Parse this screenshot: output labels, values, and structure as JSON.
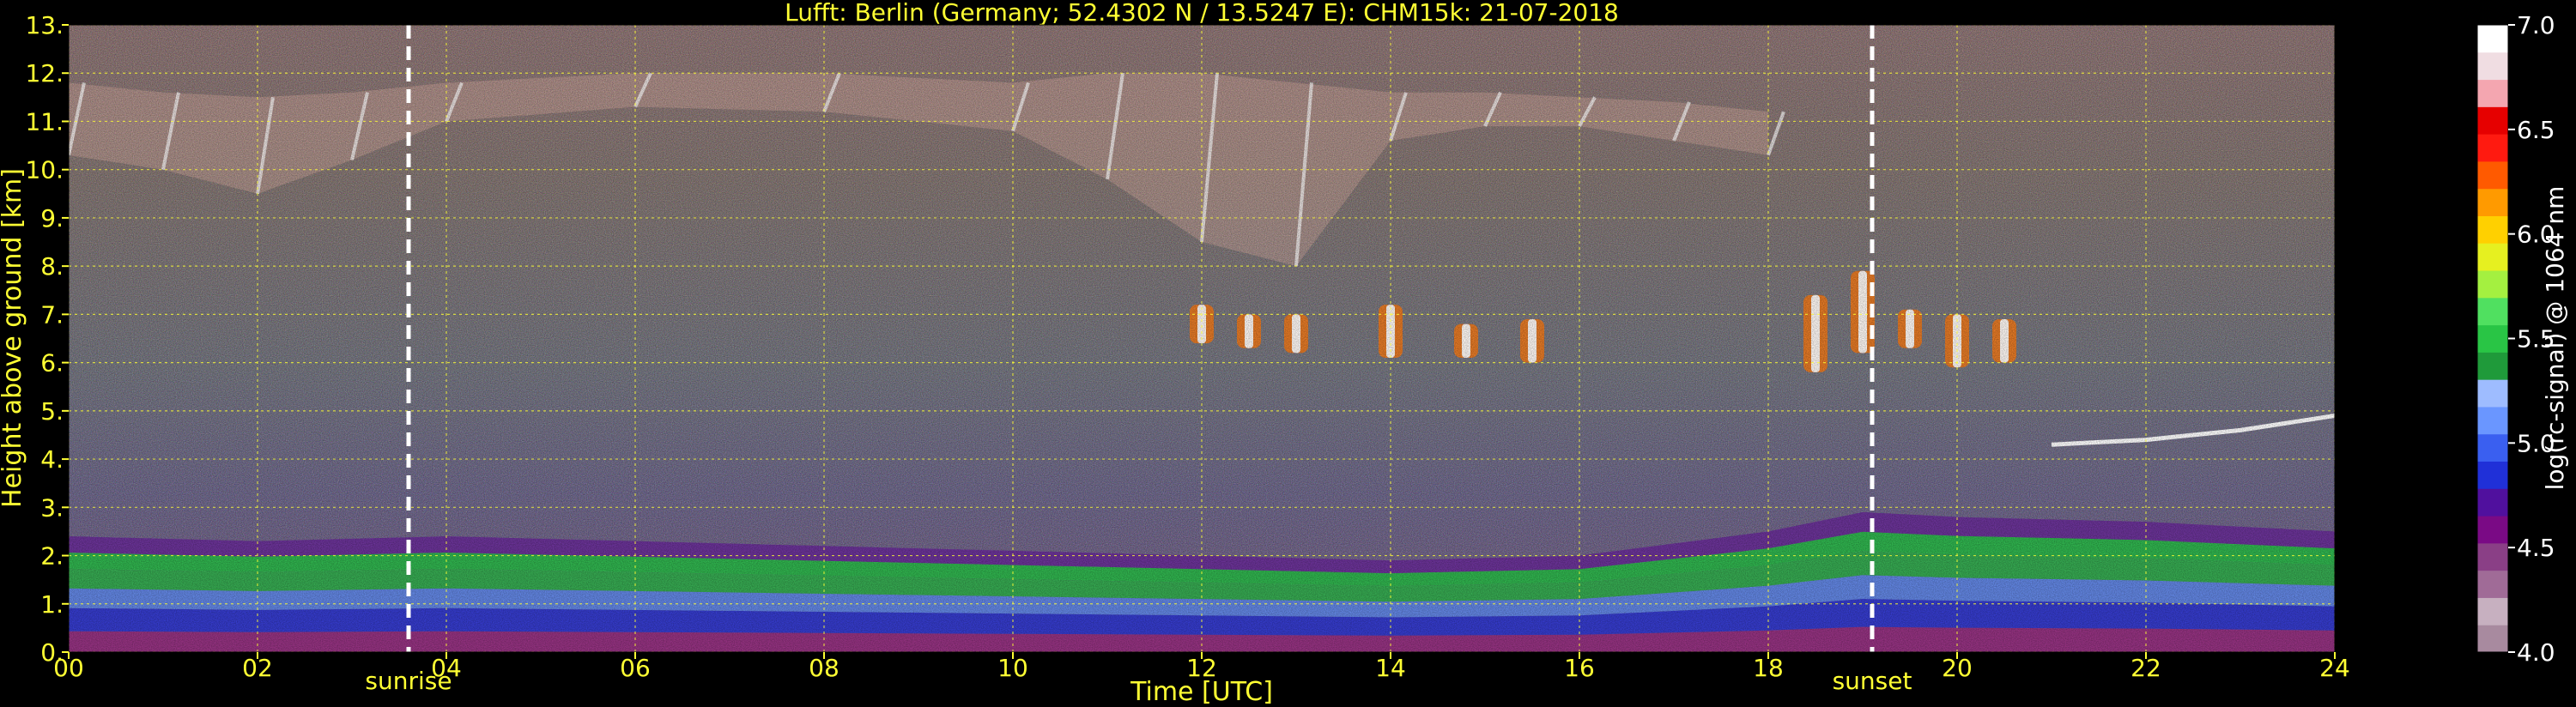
{
  "chart_data": {
    "type": "heatmap",
    "title": "Lufft: Berlin (Germany; 52.4302 N / 13.5247 E):    CHM15k: 21-07-2018",
    "xlabel": "Time [UTC]",
    "ylabel": "Height above ground [km]",
    "xlim": [
      0,
      24
    ],
    "ylim": [
      0,
      13
    ],
    "x_ticks": [
      "00",
      "02",
      "04",
      "06",
      "08",
      "10",
      "12",
      "14",
      "16",
      "18",
      "20",
      "22",
      "24"
    ],
    "y_ticks": [
      "0.",
      "1.",
      "2.",
      "3.",
      "4.",
      "5.",
      "6.",
      "7.",
      "8.",
      "9.",
      "10.",
      "11.",
      "12.",
      "13."
    ],
    "grid": true,
    "annotations": [
      {
        "label": "sunrise",
        "x": 3.6
      },
      {
        "label": "sunset",
        "x": 19.1
      }
    ],
    "colorbar": {
      "label": "log(rc-signal) @ 1064 nm",
      "range": [
        4.0,
        7.0
      ],
      "ticks": [
        "4.0",
        "4.5",
        "5.0",
        "5.5",
        "6.0",
        "6.5",
        "7.0"
      ],
      "colors": [
        "#a88a9f",
        "#c7b0c0",
        "#a06b97",
        "#8a3f86",
        "#7a0a85",
        "#50109e",
        "#2030d8",
        "#3a5ff0",
        "#6a96ff",
        "#9ebcff",
        "#1f9a3a",
        "#29c545",
        "#50e060",
        "#a4f040",
        "#e6f020",
        "#ffd000",
        "#ff9a00",
        "#ff5a00",
        "#ff1a10",
        "#e60000",
        "#f4a6b0",
        "#f0dde2",
        "#ffffff"
      ]
    },
    "layers": [
      {
        "kind": "boundary-layer",
        "t": [
          0,
          2,
          4,
          6,
          8,
          10,
          12,
          14,
          16,
          18,
          19,
          20,
          22,
          24
        ],
        "top_km": [
          2.4,
          2.3,
          2.4,
          2.3,
          2.2,
          2.1,
          2.0,
          1.9,
          2.0,
          2.5,
          2.9,
          2.8,
          2.7,
          2.5
        ]
      },
      {
        "kind": "cirrus",
        "t": [
          0,
          1,
          2,
          3,
          4,
          6,
          8,
          10,
          11,
          12,
          13,
          14,
          15,
          16,
          17,
          18
        ],
        "base_km": [
          10.3,
          10.0,
          9.5,
          10.2,
          11.0,
          11.3,
          11.2,
          10.8,
          9.8,
          8.5,
          8.0,
          10.6,
          10.9,
          10.9,
          10.6,
          10.3
        ],
        "top_km": [
          11.8,
          11.6,
          11.5,
          11.6,
          11.8,
          12.0,
          12.0,
          11.8,
          12.0,
          12.0,
          11.8,
          11.6,
          11.6,
          11.5,
          11.4,
          11.2
        ]
      },
      {
        "kind": "mid-cloud",
        "t": [
          12.0,
          12.5,
          13.0,
          14.0,
          14.8,
          15.5,
          18.5,
          19.0,
          19.5,
          20.0,
          20.5
        ],
        "base_km": [
          6.4,
          6.3,
          6.2,
          6.1,
          6.1,
          6.0,
          5.8,
          6.2,
          6.3,
          5.9,
          6.0
        ],
        "top_km": [
          7.2,
          7.0,
          7.0,
          7.2,
          6.8,
          6.9,
          7.4,
          7.9,
          7.1,
          7.0,
          6.9
        ]
      },
      {
        "kind": "elevated-layer",
        "t": [
          21.0,
          22.0,
          23.0,
          24.0
        ],
        "km": [
          4.3,
          4.4,
          4.6,
          4.9
        ]
      }
    ]
  }
}
